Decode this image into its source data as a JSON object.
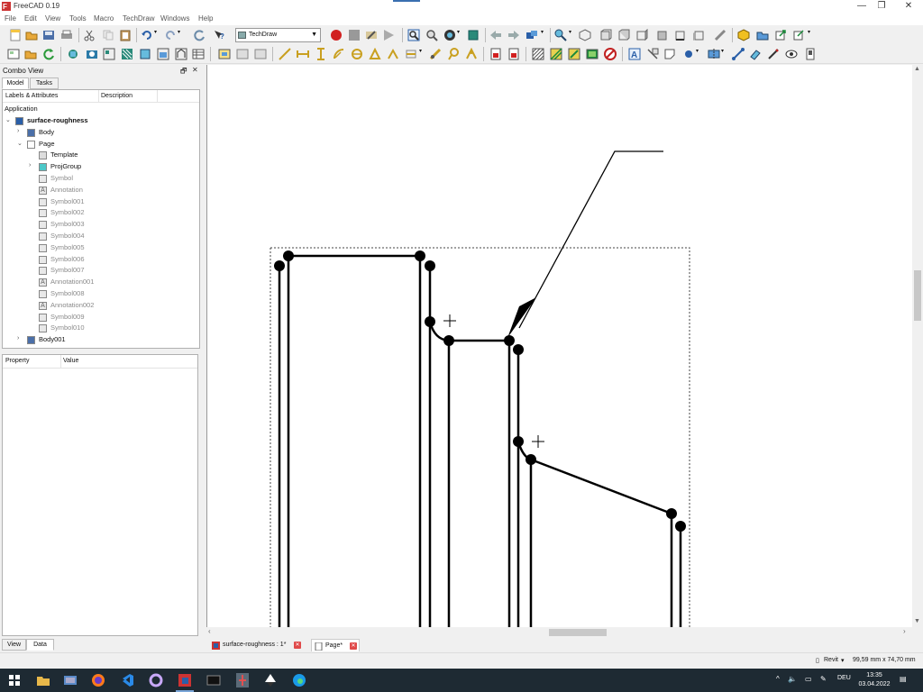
{
  "window": {
    "title": "FreeCAD 0.19",
    "minimize": "—",
    "maximize": "❐",
    "close": "✕"
  },
  "menu": [
    "File",
    "Edit",
    "View",
    "Tools",
    "Macro",
    "TechDraw",
    "Windows",
    "Help"
  ],
  "toolbar": {
    "workbench": "TechDraw"
  },
  "combo_view": {
    "title": "Combo View",
    "float_btn": "🗗",
    "close_btn": "✕",
    "tabs": [
      "Model",
      "Tasks"
    ],
    "tree_columns": [
      "Labels & Attributes",
      "Description"
    ],
    "root_label": "Application",
    "tree": [
      {
        "label": "surface-roughness",
        "bold": true,
        "icon": "document-icon",
        "expander": "⌄",
        "indent": 0
      },
      {
        "label": "Body",
        "icon": "body-icon",
        "expander": "›",
        "indent": 1
      },
      {
        "label": "Page",
        "icon": "page-icon",
        "expander": "⌄",
        "indent": 1
      },
      {
        "label": "Template",
        "icon": "template-icon",
        "expander": "",
        "indent": 2
      },
      {
        "label": "ProjGroup",
        "icon": "projgroup-icon",
        "expander": "›",
        "indent": 2
      },
      {
        "label": "Symbol",
        "icon": "symbol-icon",
        "dim": true,
        "expander": "",
        "indent": 2
      },
      {
        "label": "Annotation",
        "icon": "annotation-icon",
        "dim": true,
        "expander": "",
        "indent": 2
      },
      {
        "label": "Symbol001",
        "icon": "symbol-icon",
        "dim": true,
        "expander": "",
        "indent": 2
      },
      {
        "label": "Symbol002",
        "icon": "symbol-icon",
        "dim": true,
        "expander": "",
        "indent": 2
      },
      {
        "label": "Symbol003",
        "icon": "symbol-icon",
        "dim": true,
        "expander": "",
        "indent": 2
      },
      {
        "label": "Symbol004",
        "icon": "symbol-icon",
        "dim": true,
        "expander": "",
        "indent": 2
      },
      {
        "label": "Symbol005",
        "icon": "symbol-icon",
        "dim": true,
        "expander": "",
        "indent": 2
      },
      {
        "label": "Symbol006",
        "icon": "symbol-icon",
        "dim": true,
        "expander": "",
        "indent": 2
      },
      {
        "label": "Symbol007",
        "icon": "symbol-icon",
        "dim": true,
        "expander": "",
        "indent": 2
      },
      {
        "label": "Annotation001",
        "icon": "annotation-icon",
        "dim": true,
        "expander": "",
        "indent": 2
      },
      {
        "label": "Symbol008",
        "icon": "symbol-icon",
        "dim": true,
        "expander": "",
        "indent": 2
      },
      {
        "label": "Annotation002",
        "icon": "annotation-icon",
        "dim": true,
        "expander": "",
        "indent": 2
      },
      {
        "label": "Symbol009",
        "icon": "symbol-icon",
        "dim": true,
        "expander": "",
        "indent": 2
      },
      {
        "label": "Symbol010",
        "icon": "symbol-icon",
        "dim": true,
        "expander": "",
        "indent": 2
      },
      {
        "label": "Body001",
        "icon": "body-icon",
        "expander": "›",
        "indent": 1
      }
    ],
    "property_columns": [
      "Property",
      "Value"
    ],
    "view_tabs": [
      "View",
      "Data"
    ]
  },
  "doc_tabs": [
    {
      "label": "surface-roughness : 1*",
      "icon": "freecad-icon",
      "active": false
    },
    {
      "label": "Page*",
      "icon": "page-icon",
      "active": true
    }
  ],
  "status": {
    "navigation": "Revit",
    "navigation_arrow": "▾",
    "dimensions": "99,59 mm x 74,70 mm"
  },
  "taskbar": {
    "lang": "DEU",
    "time": "13:35",
    "date": "03.04.2022",
    "tray_up": "^",
    "speaker": "🔈",
    "network": "▭",
    "notification": "▤"
  },
  "colors": {
    "accent": "#3a6fb0",
    "close_tab": "#e04a4a",
    "taskbar": "#1e2a33",
    "drawing_line": "#000000"
  }
}
